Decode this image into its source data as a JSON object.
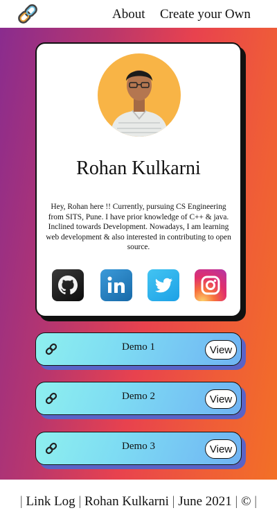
{
  "header": {
    "logo_icon": "link-chain-icon",
    "nav": {
      "about": "About",
      "create": "Create your Own"
    }
  },
  "profile": {
    "name": "Rohan Kulkarni",
    "bio": "Hey, Rohan here !! Currently, pursuing CS Engineering from SITS, Pune. I have prior knowledge of C++ & java. Inclined towards Development. Nowadays, I am learning web development & also interested in contributing to open source.",
    "avatar_bg": "#f8b446",
    "socials": [
      {
        "icon": "github-icon"
      },
      {
        "icon": "linkedin-icon"
      },
      {
        "icon": "twitter-icon"
      },
      {
        "icon": "instagram-icon"
      }
    ]
  },
  "demos": [
    {
      "label": "Demo 1",
      "button": "View",
      "icon": "link-icon"
    },
    {
      "label": "Demo 2",
      "button": "View",
      "icon": "link-icon"
    },
    {
      "label": "Demo 3",
      "button": "View",
      "icon": "link-icon"
    }
  ],
  "footer": {
    "sep": "|",
    "app": "Link Log",
    "author": "Rohan Kulkarni",
    "date": "June 2021",
    "copyright": "©"
  },
  "colors": {
    "gradient_start": "#8a2c8e",
    "gradient_mid": "#e8424e",
    "gradient_end": "#f37026",
    "demo_start": "#8ef0ef",
    "demo_end": "#6fb3f3",
    "demo_shadow": "#5963c7"
  }
}
